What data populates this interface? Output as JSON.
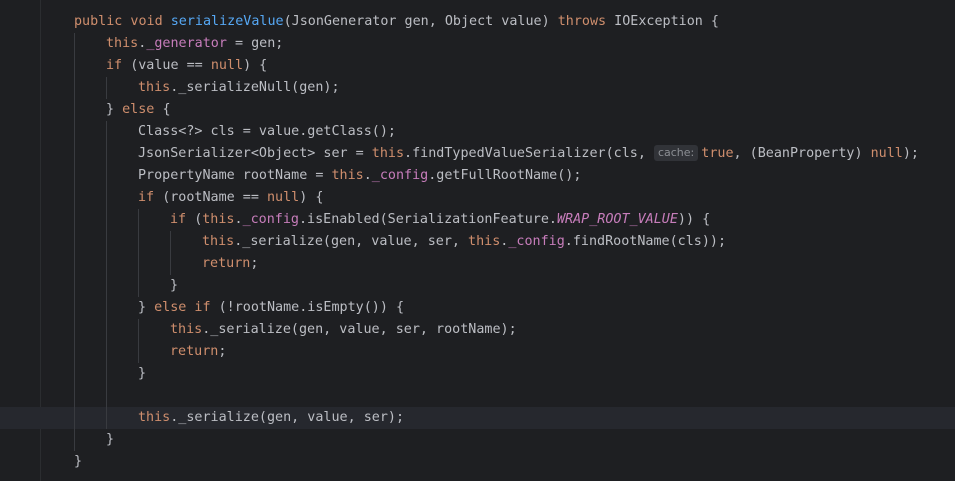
{
  "editor": {
    "lines": [
      {
        "id": "l1",
        "indent": 0,
        "parts": [
          [
            "kw",
            "public void "
          ],
          [
            "fn",
            "serializeValue"
          ],
          [
            "",
            "(JsonGenerator gen, Object value) "
          ],
          [
            "kw",
            "throws "
          ],
          [
            "",
            "IOException {"
          ]
        ]
      },
      {
        "id": "l2",
        "indent": 1,
        "parts": [
          [
            "kw",
            "this"
          ],
          [
            "",
            "."
          ],
          [
            "field",
            "_generator"
          ],
          [
            "",
            " = gen;"
          ]
        ]
      },
      {
        "id": "l3",
        "indent": 1,
        "parts": [
          [
            "kw",
            "if "
          ],
          [
            "",
            "(value == "
          ],
          [
            "kw",
            "null"
          ],
          [
            "",
            ") {"
          ]
        ]
      },
      {
        "id": "l4",
        "indent": 2,
        "parts": [
          [
            "kw",
            "this"
          ],
          [
            "",
            "._serializeNull(gen);"
          ]
        ]
      },
      {
        "id": "l5",
        "indent": 1,
        "parts": [
          [
            "",
            "} "
          ],
          [
            "kw",
            "else "
          ],
          [
            "",
            "{"
          ]
        ]
      },
      {
        "id": "l6",
        "indent": 2,
        "parts": [
          [
            "",
            "Class<?> cls = value.getClass();"
          ]
        ]
      },
      {
        "id": "l7",
        "indent": 2,
        "parts": [
          [
            "",
            "JsonSerializer<Object> ser = "
          ],
          [
            "kw",
            "this"
          ],
          [
            "",
            ".findTypedValueSerializer(cls, "
          ],
          [
            "hint",
            "cache:"
          ],
          [
            "kw",
            "true"
          ],
          [
            "",
            ", (BeanProperty) "
          ],
          [
            "kw",
            "null"
          ],
          [
            "",
            ");"
          ]
        ]
      },
      {
        "id": "l8",
        "indent": 2,
        "parts": [
          [
            "",
            "PropertyName rootName = "
          ],
          [
            "kw",
            "this"
          ],
          [
            "",
            "."
          ],
          [
            "field",
            "_config"
          ],
          [
            "",
            ".getFullRootName();"
          ]
        ]
      },
      {
        "id": "l9",
        "indent": 2,
        "parts": [
          [
            "kw",
            "if "
          ],
          [
            "",
            "(rootName == "
          ],
          [
            "kw",
            "null"
          ],
          [
            "",
            ") {"
          ]
        ]
      },
      {
        "id": "l10",
        "indent": 3,
        "parts": [
          [
            "kw",
            "if "
          ],
          [
            "",
            "("
          ],
          [
            "kw",
            "this"
          ],
          [
            "",
            "."
          ],
          [
            "field",
            "_config"
          ],
          [
            "",
            ".isEnabled(SerializationFeature."
          ],
          [
            "const",
            "WRAP_ROOT_VALUE"
          ],
          [
            "",
            ")) {"
          ]
        ]
      },
      {
        "id": "l11",
        "indent": 4,
        "parts": [
          [
            "kw",
            "this"
          ],
          [
            "",
            "._serialize(gen, value, ser, "
          ],
          [
            "kw",
            "this"
          ],
          [
            "",
            "."
          ],
          [
            "field",
            "_config"
          ],
          [
            "",
            ".findRootName(cls));"
          ]
        ]
      },
      {
        "id": "l12",
        "indent": 4,
        "parts": [
          [
            "kw",
            "return"
          ],
          [
            "",
            ";"
          ]
        ]
      },
      {
        "id": "l13",
        "indent": 3,
        "parts": [
          [
            "",
            "}"
          ]
        ]
      },
      {
        "id": "l14",
        "indent": 2,
        "parts": [
          [
            "",
            "} "
          ],
          [
            "kw",
            "else if "
          ],
          [
            "",
            "(!rootName.isEmpty()) {"
          ]
        ]
      },
      {
        "id": "l15",
        "indent": 3,
        "parts": [
          [
            "kw",
            "this"
          ],
          [
            "",
            "._serialize(gen, value, ser, rootName);"
          ]
        ]
      },
      {
        "id": "l16",
        "indent": 3,
        "parts": [
          [
            "kw",
            "return"
          ],
          [
            "",
            ";"
          ]
        ]
      },
      {
        "id": "l17",
        "indent": 2,
        "parts": [
          [
            "",
            "}"
          ]
        ]
      },
      {
        "id": "l18",
        "indent": 2,
        "parts": []
      },
      {
        "id": "l19",
        "indent": 2,
        "parts": [
          [
            "kw",
            "this"
          ],
          [
            "",
            "._serialize(gen, value, ser);"
          ]
        ],
        "current": true
      },
      {
        "id": "l20",
        "indent": 1,
        "parts": [
          [
            "",
            "}"
          ]
        ]
      },
      {
        "id": "l21",
        "indent": 0,
        "parts": [
          [
            "",
            "}"
          ]
        ]
      }
    ]
  },
  "colors": {
    "background": "#1e1f22",
    "keyword": "#cf8e6d",
    "method": "#56a8f5",
    "field": "#c77dbb",
    "text": "#bcbec4"
  }
}
